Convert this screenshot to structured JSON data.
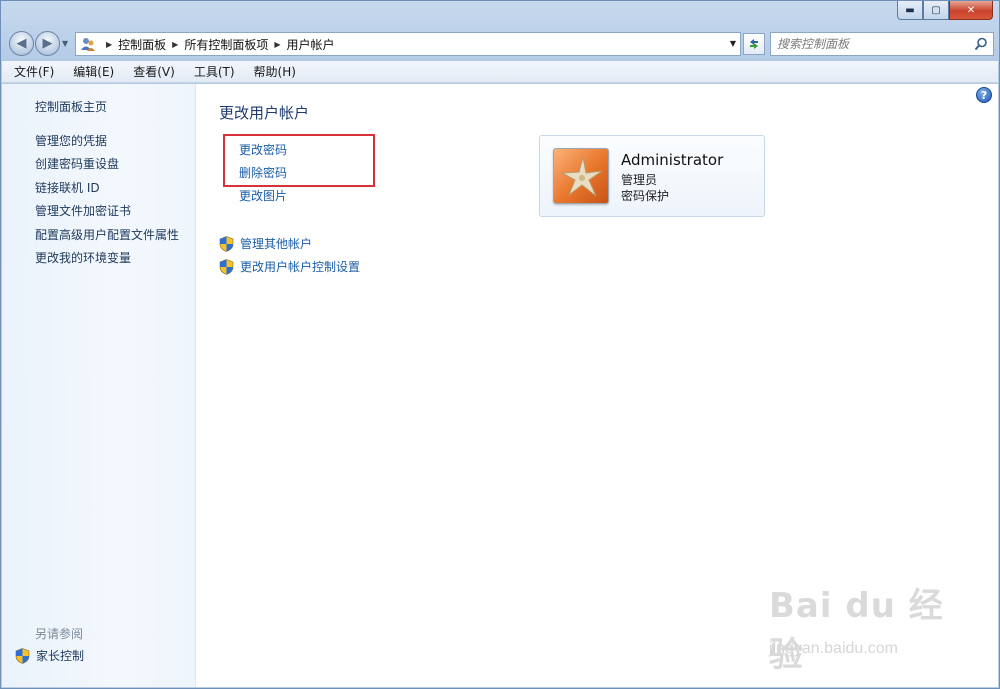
{
  "window": {
    "controls": {
      "minimize": "▬",
      "maximize": "▢",
      "close": "✕"
    }
  },
  "address": {
    "crumbs": [
      "控制面板",
      "所有控制面板项",
      "用户帐户"
    ],
    "search_placeholder": "搜索控制面板"
  },
  "menubar": {
    "items": [
      "文件(F)",
      "编辑(E)",
      "查看(V)",
      "工具(T)",
      "帮助(H)"
    ]
  },
  "sidebar": {
    "home": "控制面板主页",
    "links": [
      "管理您的凭据",
      "创建密码重设盘",
      "链接联机 ID",
      "管理文件加密证书",
      "配置高级用户配置文件属性",
      "更改我的环境变量"
    ],
    "see_also": "另请参阅",
    "parental": "家长控制"
  },
  "main": {
    "title": "更改用户帐户",
    "tasks": [
      "更改密码",
      "删除密码",
      "更改图片"
    ],
    "shield_tasks": [
      "管理其他帐户",
      "更改用户帐户控制设置"
    ],
    "help_glyph": "?"
  },
  "account": {
    "name": "Administrator",
    "role": "管理员",
    "status": "密码保护"
  },
  "watermark": {
    "logo": "Bai du 经验",
    "url": "jingyan.baidu.com"
  },
  "colors": {
    "link": "#1b5ea8",
    "title": "#1e3a70",
    "highlight": "#d7323a"
  }
}
